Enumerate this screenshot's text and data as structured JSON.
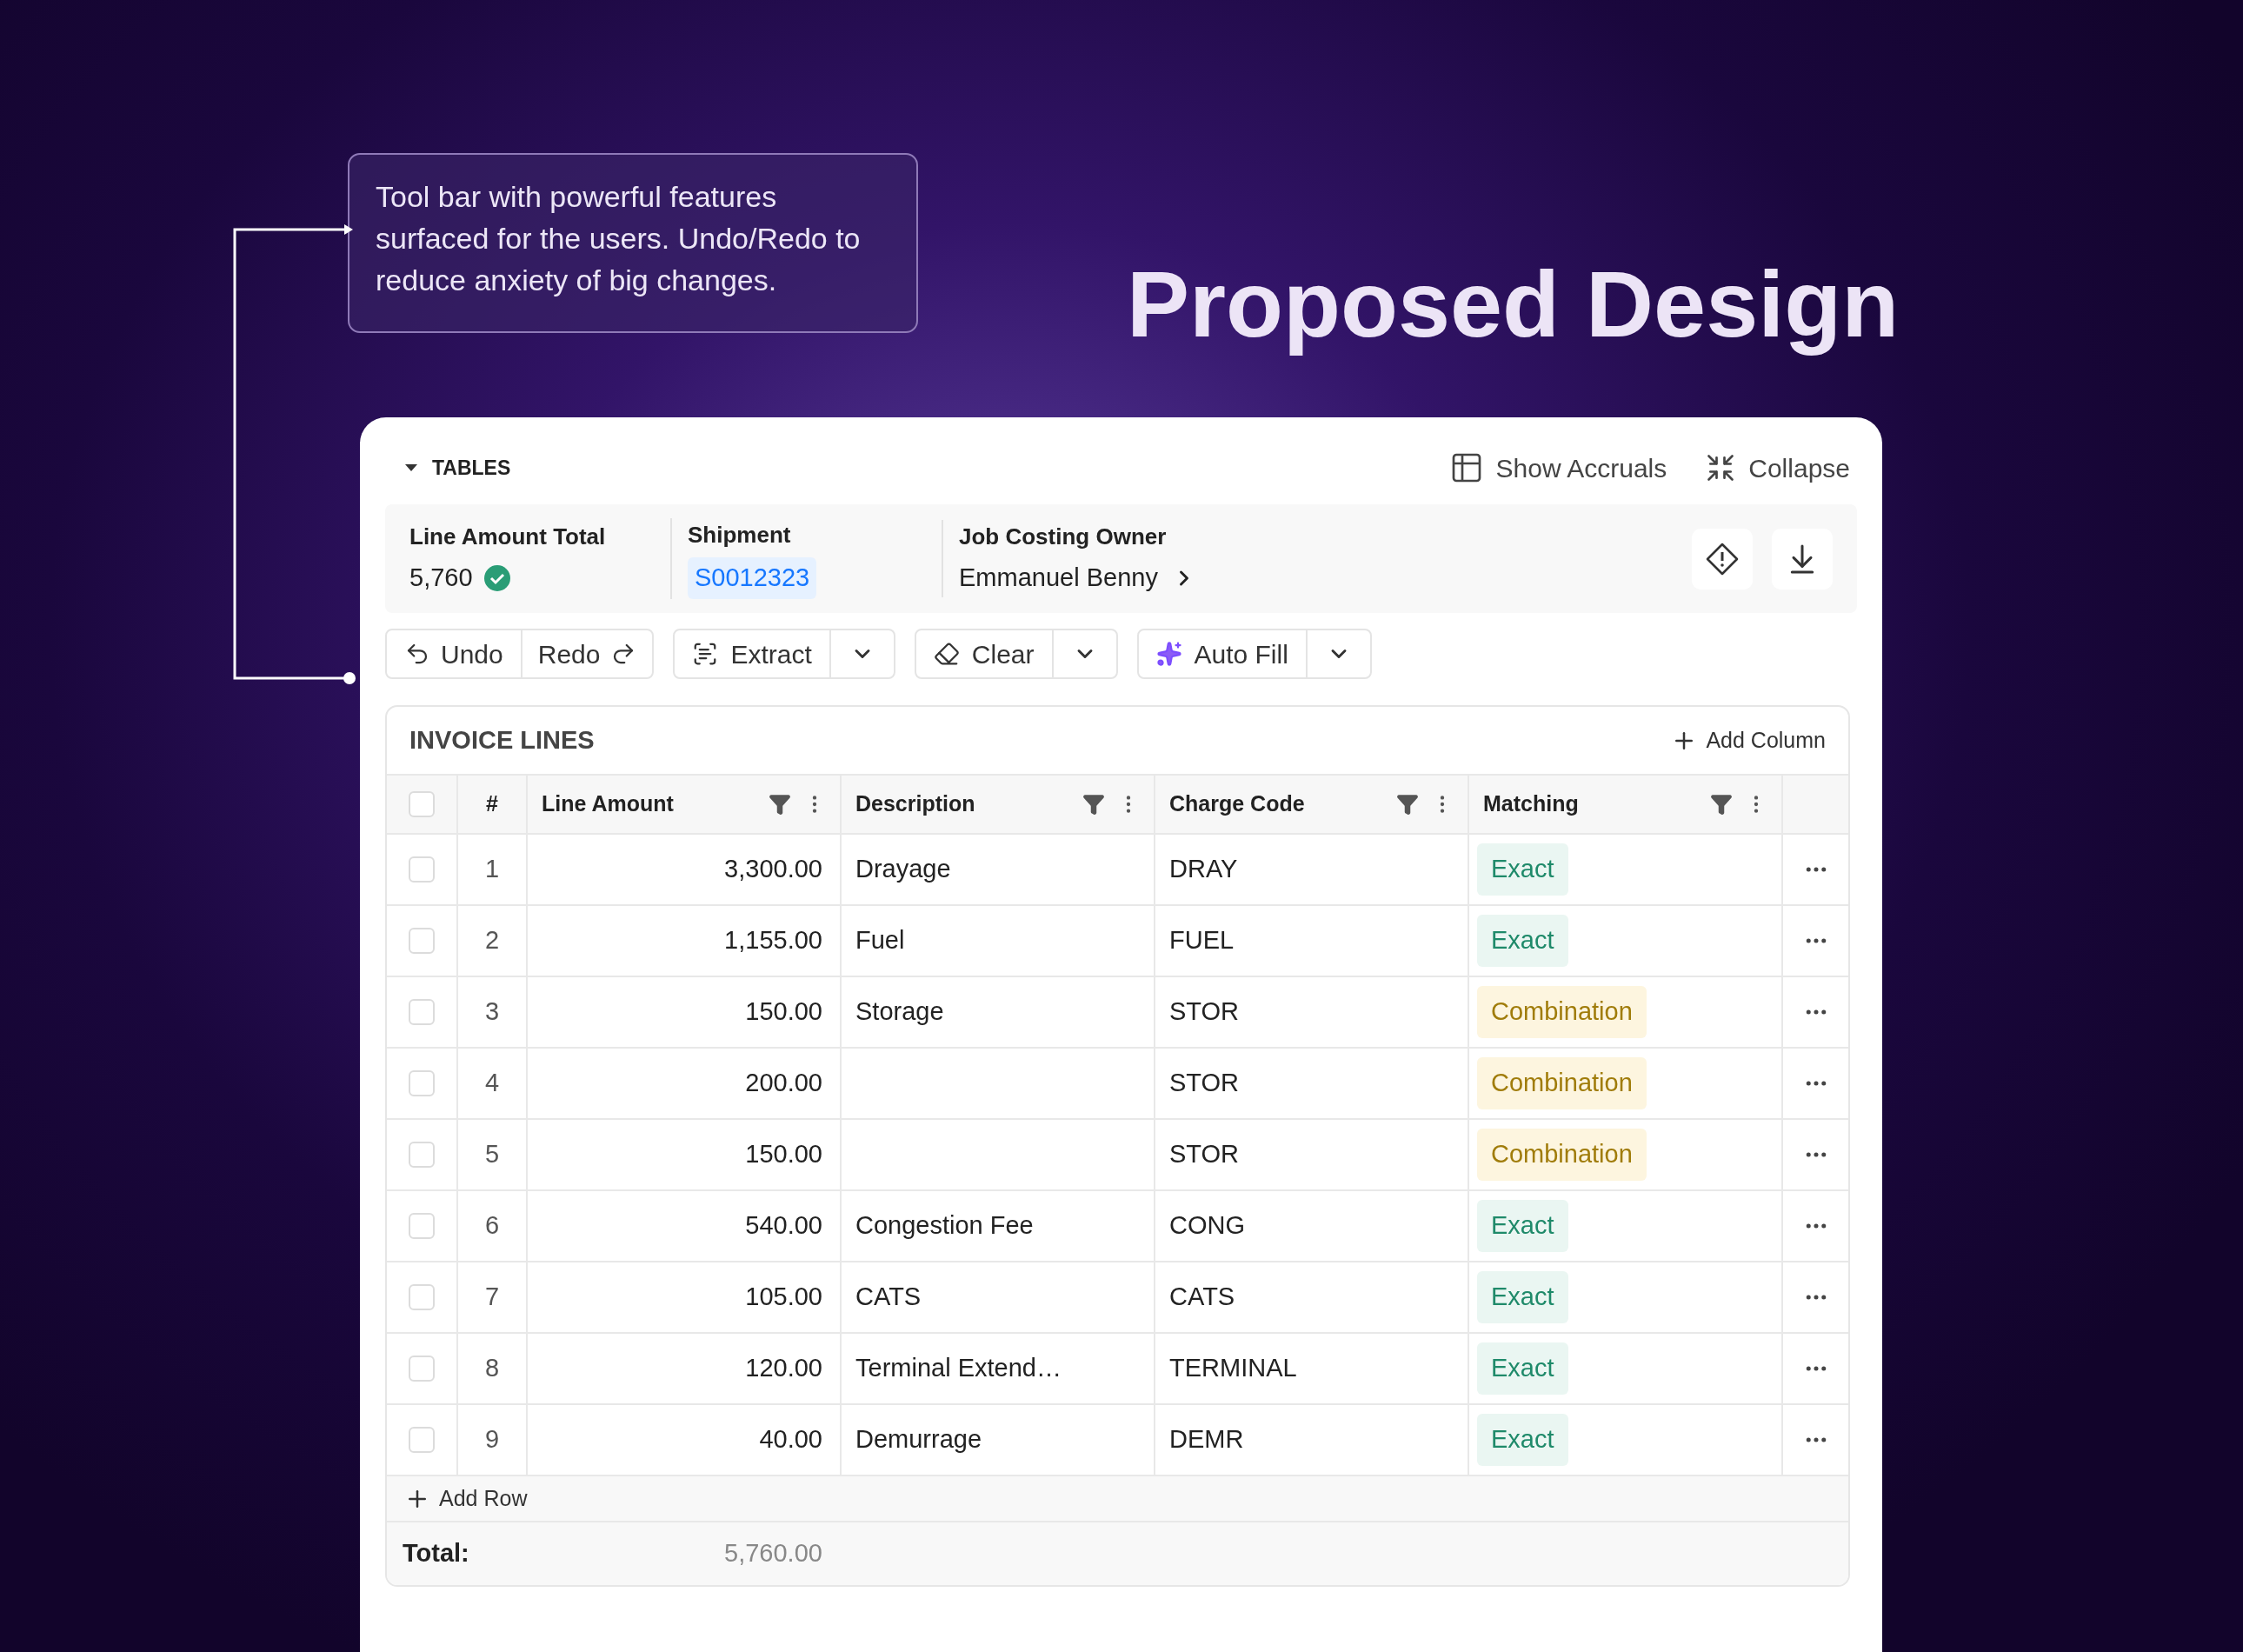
{
  "annotation": {
    "text": "Tool bar with powerful features surfaced for the users. Undo/Redo to reduce anxiety of big changes."
  },
  "title": "Proposed Design",
  "panel": {
    "section_label": "TABLES",
    "expanded": true,
    "actions": [
      "Show Accruals",
      "Collapse"
    ]
  },
  "summary": [
    {
      "kind": "total",
      "label": "Line Amount Total",
      "value": "5,760",
      "verified": true
    },
    {
      "kind": "link",
      "label": "Shipment",
      "value": "S0012323"
    },
    {
      "kind": "person",
      "label": "Job Costing Owner",
      "value": "Emmanuel Benny"
    }
  ],
  "toolbar": [
    {
      "kind": "pair",
      "labels": [
        "Undo",
        "Redo"
      ]
    },
    {
      "kind": "split",
      "labels": [
        "Extract"
      ]
    },
    {
      "kind": "split",
      "labels": [
        "Clear"
      ]
    },
    {
      "kind": "split",
      "labels": [
        "Auto Fill"
      ]
    }
  ],
  "table": {
    "title": "INVOICE LINES",
    "add_column": "Add Column",
    "all_checked": false,
    "columns": [
      "#",
      "Line Amount",
      "Description",
      "Charge Code",
      "Matching"
    ],
    "rows": [
      {
        "number": "1",
        "line_amount": "3,300.00",
        "description": "Drayage",
        "charge_code": "DRAY",
        "matching": "Exact",
        "kind": "exact",
        "checked": false
      },
      {
        "number": "2",
        "line_amount": "1,155.00",
        "description": "Fuel",
        "charge_code": "FUEL",
        "matching": "Exact",
        "kind": "exact",
        "checked": false
      },
      {
        "number": "3",
        "line_amount": "150.00",
        "description": "Storage",
        "charge_code": "STOR",
        "matching": "Combination",
        "kind": "combination",
        "checked": false
      },
      {
        "number": "4",
        "line_amount": "200.00",
        "charge_code": "STOR",
        "matching": "Combination",
        "kind": "combination",
        "checked": false
      },
      {
        "number": "5",
        "line_amount": "150.00",
        "charge_code": "STOR",
        "matching": "Combination",
        "kind": "combination",
        "checked": false
      },
      {
        "number": "6",
        "line_amount": "540.00",
        "description": "Congestion Fee",
        "charge_code": "CONG",
        "matching": "Exact",
        "kind": "exact",
        "checked": false
      },
      {
        "number": "7",
        "line_amount": "105.00",
        "description": "CATS",
        "charge_code": "CATS",
        "matching": "Exact",
        "kind": "exact",
        "checked": false
      },
      {
        "number": "8",
        "line_amount": "120.00",
        "description": "Terminal Extend…",
        "charge_code": "TERMINAL",
        "matching": "Exact",
        "kind": "exact",
        "checked": false
      },
      {
        "number": "9",
        "line_amount": "40.00",
        "description": "Demurrage",
        "charge_code": "DEMR",
        "matching": "Exact",
        "kind": "exact",
        "checked": false
      }
    ],
    "add_row": "Add Row",
    "total_label": "Total:",
    "total_value": "5,760.00"
  }
}
